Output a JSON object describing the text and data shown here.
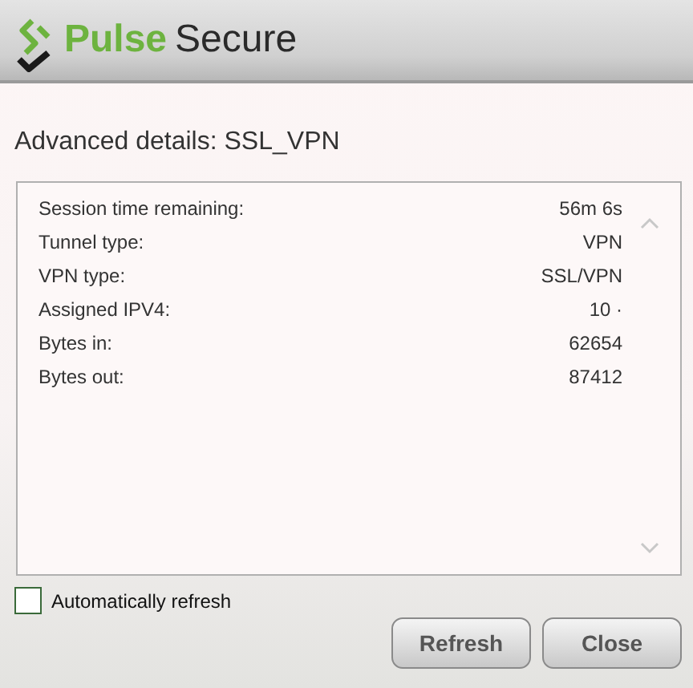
{
  "header": {
    "logo_brand": "Pulse",
    "logo_product": "Secure"
  },
  "title": "Advanced details: SSL_VPN",
  "details": [
    {
      "label": "Session time remaining:",
      "value": "56m 6s"
    },
    {
      "label": "Tunnel type:",
      "value": "VPN"
    },
    {
      "label": "VPN type:",
      "value": "SSL/VPN"
    },
    {
      "label": "Assigned IPV4:",
      "value": "10 ·"
    },
    {
      "label": "Bytes in:",
      "value": "62654"
    },
    {
      "label": "Bytes out:",
      "value": "87412"
    }
  ],
  "auto_refresh": {
    "label": "Automatically refresh",
    "checked": false
  },
  "buttons": [
    "Refresh",
    "Close"
  ]
}
